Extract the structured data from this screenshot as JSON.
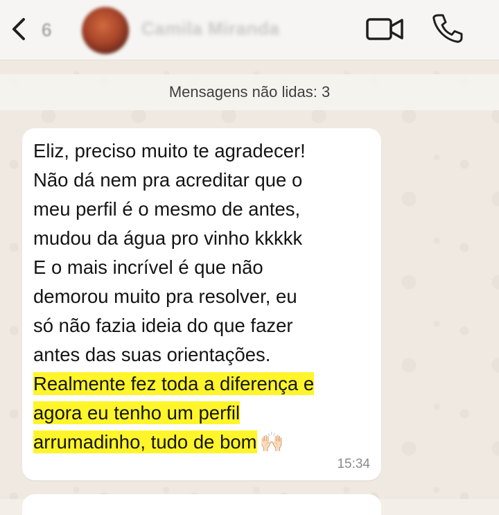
{
  "header": {
    "back_count": "6",
    "contact_name": "Camila Miranda"
  },
  "chat": {
    "unread_banner": "Mensagens não lidas: 3",
    "message": {
      "lines": [
        "Eliz, preciso muito te agradecer!",
        "Não dá nem pra acreditar que o",
        "meu perfil é o mesmo de antes,",
        "mudou da água pro vinho kkkkk",
        "E o mais incrível é que não",
        "demorou muito pra resolver, eu",
        "só não fazia ideia do que fazer",
        "antes das suas orientações."
      ],
      "highlighted_lines": [
        "Realmente fez toda a diferença e",
        "agora eu tenho um perfil",
        "arrumadinho, tudo de bom"
      ],
      "emoji": "🙌🏻",
      "time": "15:34",
      "highlight_color": "#fff52a"
    }
  },
  "icons": {
    "back": "chevron-left-icon",
    "video": "video-camera-icon",
    "call": "phone-icon"
  }
}
